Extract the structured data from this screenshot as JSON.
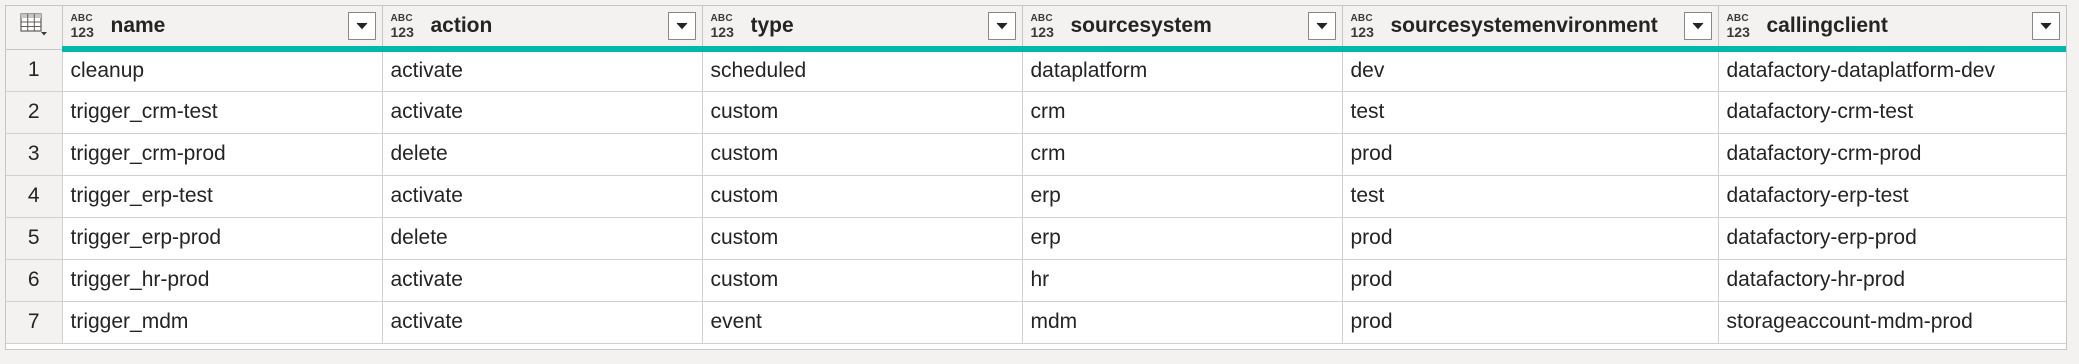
{
  "grid": {
    "columns": [
      {
        "key": "name",
        "label": "name",
        "type_top": "ABC",
        "type_bottom": "123"
      },
      {
        "key": "action",
        "label": "action",
        "type_top": "ABC",
        "type_bottom": "123"
      },
      {
        "key": "type",
        "label": "type",
        "type_top": "ABC",
        "type_bottom": "123"
      },
      {
        "key": "sourcesystem",
        "label": "sourcesystem",
        "type_top": "ABC",
        "type_bottom": "123"
      },
      {
        "key": "sourcesystemenvironment",
        "label": "sourcesystemenvironment",
        "type_top": "ABC",
        "type_bottom": "123"
      },
      {
        "key": "callingclient",
        "label": "callingclient",
        "type_top": "ABC",
        "type_bottom": "123"
      }
    ],
    "rows": [
      {
        "num": "1",
        "cells": [
          "cleanup",
          "activate",
          "scheduled",
          "dataplatform",
          "dev",
          "datafactory-dataplatform-dev"
        ]
      },
      {
        "num": "2",
        "cells": [
          "trigger_crm-test",
          "activate",
          "custom",
          "crm",
          "test",
          "datafactory-crm-test"
        ]
      },
      {
        "num": "3",
        "cells": [
          "trigger_crm-prod",
          "delete",
          "custom",
          "crm",
          "prod",
          "datafactory-crm-prod"
        ]
      },
      {
        "num": "4",
        "cells": [
          "trigger_erp-test",
          "activate",
          "custom",
          "erp",
          "test",
          "datafactory-erp-test"
        ]
      },
      {
        "num": "5",
        "cells": [
          "trigger_erp-prod",
          "delete",
          "custom",
          "erp",
          "prod",
          "datafactory-erp-prod"
        ]
      },
      {
        "num": "6",
        "cells": [
          "trigger_hr-prod",
          "activate",
          "custom",
          "hr",
          "prod",
          "datafactory-hr-prod"
        ]
      },
      {
        "num": "7",
        "cells": [
          "trigger_mdm",
          "activate",
          "event",
          "mdm",
          "prod",
          "storageaccount-mdm-prod"
        ]
      }
    ]
  },
  "colors": {
    "column_quality_bar": "#01b8aa",
    "header_background": "#f3f2f1",
    "grid_border": "#d2d0ce"
  },
  "icons": {
    "corner": "table-icon",
    "column_type": "any-type-icon",
    "column_filter": "chevron-down-icon"
  }
}
